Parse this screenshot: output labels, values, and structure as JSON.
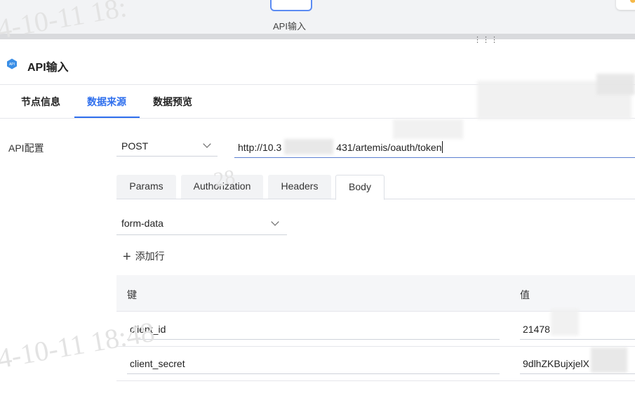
{
  "canvas": {
    "node_label": "API输入"
  },
  "panel": {
    "title": "API输入",
    "icon_text": "API"
  },
  "tabs": [
    {
      "label": "节点信息"
    },
    {
      "label": "数据来源",
      "active": true
    },
    {
      "label": "数据预览"
    }
  ],
  "config": {
    "label": "API配置",
    "method": "POST",
    "url_prefix": "http://10.3",
    "url_suffix": "431/artemis/oauth/token"
  },
  "body_tabs": [
    {
      "label": "Params"
    },
    {
      "label": "Authorization"
    },
    {
      "label": "Headers"
    },
    {
      "label": "Body",
      "active": true
    }
  ],
  "body": {
    "format": "form-data",
    "add_row_label": "添加行",
    "columns": [
      "键",
      "值"
    ],
    "rows": [
      {
        "key": "client_id",
        "value": "21478"
      },
      {
        "key": "client_secret",
        "value": "9dlhZKBujxjelX"
      }
    ]
  },
  "watermarks": [
    "4-10-11 18:",
    "4-10-11 18:48",
    "28"
  ],
  "colors": {
    "accent": "#2f6fed",
    "tab_active": "#2f6fed",
    "api_icon": "#3a8ee6"
  }
}
